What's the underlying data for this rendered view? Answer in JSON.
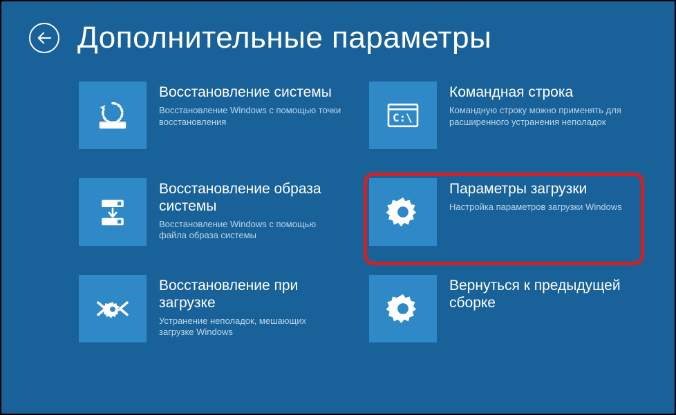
{
  "header": {
    "title": "Дополнительные параметры"
  },
  "tiles": {
    "system_restore": {
      "title": "Восстановление системы",
      "desc": "Восстановление Windows с помощью точки восстановления"
    },
    "command_prompt": {
      "title": "Командная строка",
      "desc": "Командную строку можно применять для расширенного устранения неполадок"
    },
    "image_recovery": {
      "title": "Восстановление образа системы",
      "desc": "Восстановление Windows с помощью файла образа системы"
    },
    "startup_settings": {
      "title": "Параметры загрузки",
      "desc": "Настройка параметров загрузки Windows"
    },
    "startup_repair": {
      "title": "Восстановление при загрузке",
      "desc": "Устранение неполадок, мешающих загрузке Windows"
    },
    "revert_build": {
      "title": "Вернуться к предыдущей сборке",
      "desc": ""
    }
  }
}
